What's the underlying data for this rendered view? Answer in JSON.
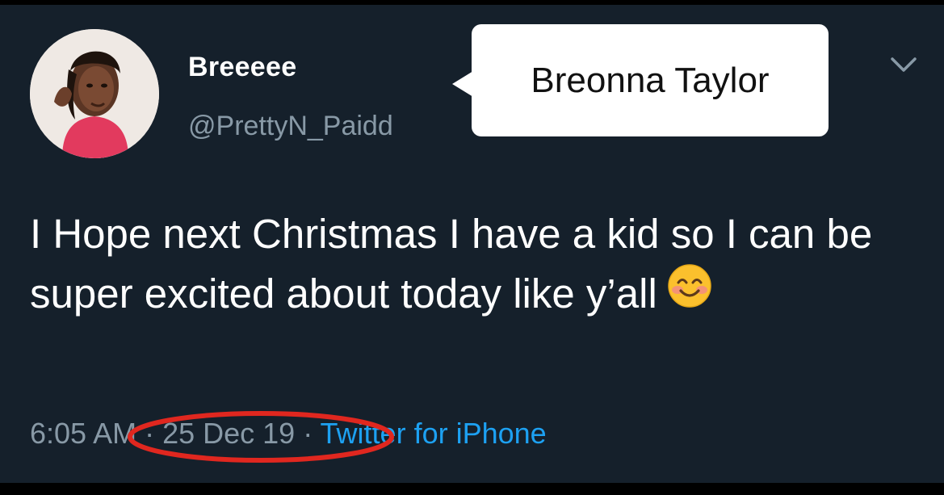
{
  "caption": {
    "text": "Breonna Taylor"
  },
  "user": {
    "display_name": "Breeeee",
    "handle": "@PrettyN_Paidd",
    "avatar_icon": "profile-photo"
  },
  "tweet": {
    "text": "I Hope next Christmas I have a kid so I can be super excited about today like y’all",
    "emoji": "smiling-face-with-smiling-eyes"
  },
  "meta": {
    "time": "6:05 AM",
    "separator": " · ",
    "date": "25 Dec 19",
    "source": "Twitter for iPhone"
  },
  "annotation": {
    "color": "#e0271f"
  },
  "menu": {
    "icon": "chevron-down-icon"
  },
  "colors": {
    "background": "#15202b",
    "text": "#ffffff",
    "secondary": "#8899a6",
    "link": "#1da1f2"
  }
}
